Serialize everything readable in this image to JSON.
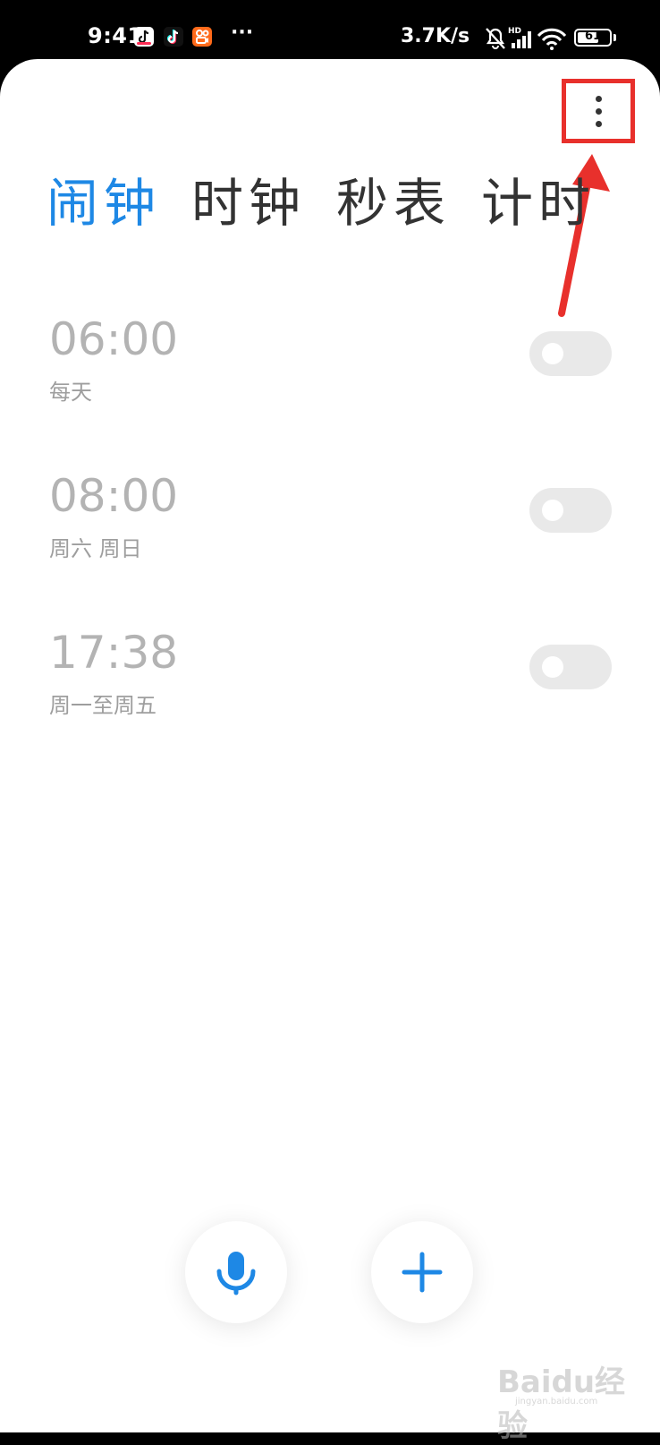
{
  "status_bar": {
    "time": "9:41",
    "more_indicator": "···",
    "network_speed": "3.7K/s",
    "network_badge": "HD",
    "battery_level": "61",
    "icons": [
      "tiktok-lite-icon",
      "tiktok-icon",
      "kuaishou-icon",
      "mute-bell-icon",
      "signal-icon",
      "wifi-icon",
      "battery-icon"
    ]
  },
  "tabs": [
    {
      "label": "闹钟",
      "active": true
    },
    {
      "label": "时钟",
      "active": false
    },
    {
      "label": "秒表",
      "active": false
    },
    {
      "label": "计时",
      "active": false
    }
  ],
  "alarms": [
    {
      "time": "06:00",
      "repeat": "每天",
      "enabled": false
    },
    {
      "time": "08:00",
      "repeat": "周六 周日",
      "enabled": false
    },
    {
      "time": "17:38",
      "repeat": "周一至周五",
      "enabled": false
    }
  ],
  "actions": {
    "more_icon": "more-vertical-icon",
    "voice_icon": "microphone-icon",
    "add_icon": "plus-icon"
  },
  "annotation": {
    "highlight_color": "#e8302c"
  },
  "watermark": {
    "brand": "Baidu经验",
    "site": "jingyan.baidu.com"
  },
  "colors": {
    "accent": "#1e88e5",
    "text_primary": "#333333",
    "text_disabled": "#b3b3b3",
    "toggle_off": "#e9e9e9"
  }
}
